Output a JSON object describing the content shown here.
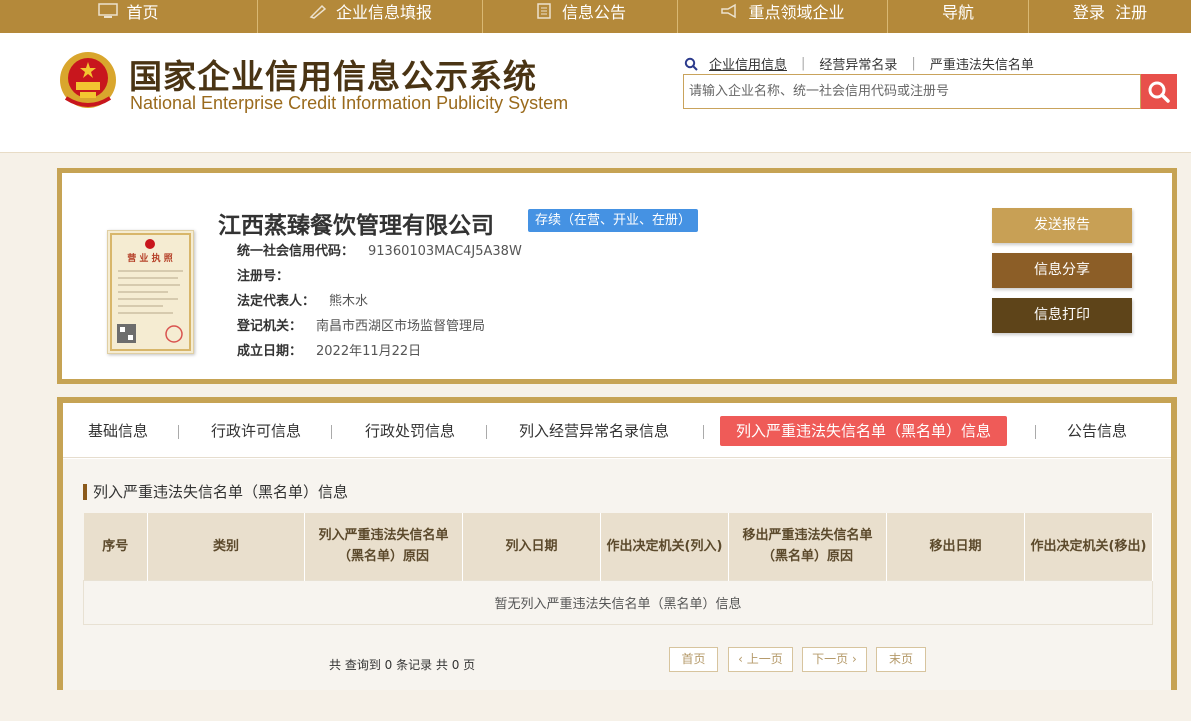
{
  "topnav": {
    "items": [
      {
        "label": "首页",
        "icon": "monitor-icon"
      },
      {
        "label": "企业信息填报",
        "icon": "pen-icon"
      },
      {
        "label": "信息公告",
        "icon": "document-icon"
      },
      {
        "label": "重点领域企业",
        "icon": "megaphone-icon"
      },
      {
        "label": "导航",
        "icon": ""
      },
      {
        "label": "登录  注册",
        "icon": ""
      }
    ]
  },
  "header": {
    "title": "国家企业信用信息公示系统",
    "subtitle": "National Enterprise Credit Information Publicity System",
    "search_links": [
      "企业信用信息",
      "经营异常名录",
      "严重违法失信名单"
    ],
    "search_placeholder": "请输入企业名称、统一社会信用代码或注册号"
  },
  "company": {
    "name": "江西蒸臻餐饮管理有限公司",
    "status": "存续（在营、开业、在册）",
    "license_title": "营 业 执 照",
    "fields": [
      {
        "key": "统一社会信用代码：",
        "value": "91360103MAC4J5A38W"
      },
      {
        "key": "注册号：",
        "value": ""
      },
      {
        "key": "法定代表人：",
        "value": "熊木水"
      },
      {
        "key": "登记机关：",
        "value": "南昌市西湖区市场监督管理局"
      },
      {
        "key": "成立日期：",
        "value": "2022年11月22日"
      }
    ],
    "actions": [
      "发送报告",
      "信息分享",
      "信息打印"
    ]
  },
  "tabs": {
    "items": [
      "基础信息",
      "行政许可信息",
      "行政处罚信息",
      "列入经营异常名录信息",
      "列入严重违法失信名单（黑名单）信息",
      "公告信息"
    ],
    "active_index": 4
  },
  "section": {
    "title": "列入严重违法失信名单（黑名单）信息",
    "columns": [
      "序号",
      "类别",
      "列入严重违法失信名单（黑名单）原因",
      "列入日期",
      "作出决定机关(列入)",
      "移出严重违法失信名单（黑名单）原因",
      "移出日期",
      "作出决定机关(移出)"
    ],
    "empty_text": "暂无列入严重违法失信名单（黑名单）信息",
    "pager_info": "共 查询到 0 条记录 共 0 页",
    "pager": {
      "first": "首页",
      "prev": "上一页",
      "next": "下一页",
      "last": "末页"
    }
  },
  "colors": {
    "nav": "#b4893a",
    "accent_red": "#ef5b58",
    "badge_blue": "#4592e3",
    "btn1": "#c8a055",
    "btn2": "#8c5e27",
    "btn3": "#5e4419"
  }
}
